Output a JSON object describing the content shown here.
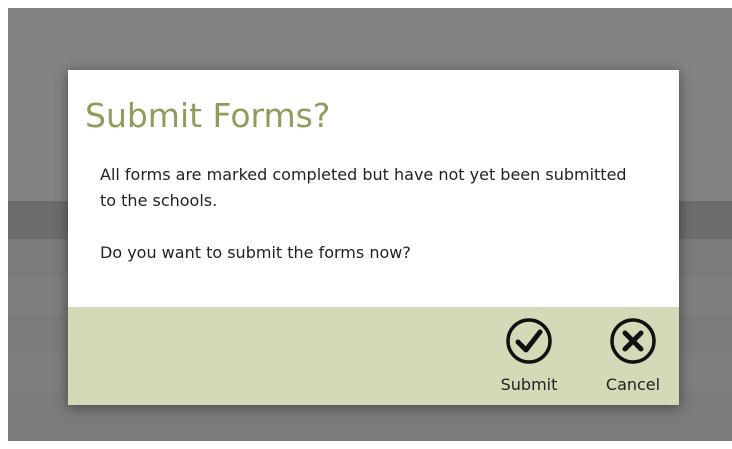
{
  "dialog": {
    "title": "Submit Forms?",
    "message_line1": "All forms are marked completed but have not yet been submitted to the schools.",
    "message_line2": "Do you want to submit the forms now?",
    "actions": {
      "submit": {
        "label": "Submit",
        "icon": "check-circle-icon"
      },
      "cancel": {
        "label": "Cancel",
        "icon": "close-circle-icon"
      }
    }
  },
  "colors": {
    "title": "#939a5b",
    "footer": "#d6d9b8",
    "overlay": "#838383"
  }
}
